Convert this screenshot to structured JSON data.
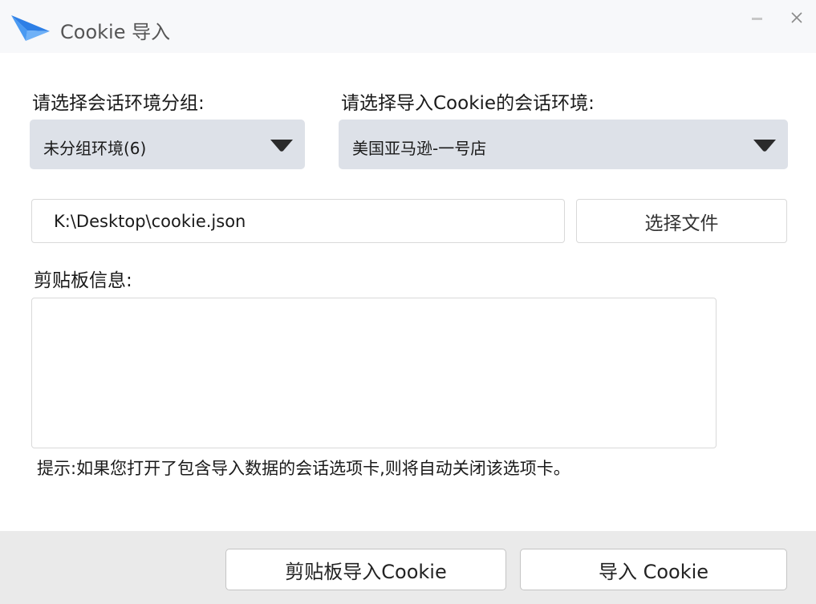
{
  "window": {
    "title": "Cookie 导入",
    "logo_icon": "bird-logo-icon",
    "accent_color": "#3d8ef0"
  },
  "form": {
    "group_label": "请选择会话环境分组:",
    "group_selected": "未分组环境(6)",
    "env_label": "请选择导入Cookie的会话环境:",
    "env_selected": "美国亚马逊-一号店",
    "file_path": "K:\\Desktop\\cookie.json",
    "choose_file_label": "选择文件",
    "clipboard_label": "剪贴板信息:",
    "clipboard_value": "",
    "hint": "提示:如果您打开了包含导入数据的会话选项卡,则将自动关闭该选项卡。"
  },
  "footer": {
    "clipboard_import_label": "剪贴板导入Cookie",
    "import_label": "导入 Cookie"
  }
}
